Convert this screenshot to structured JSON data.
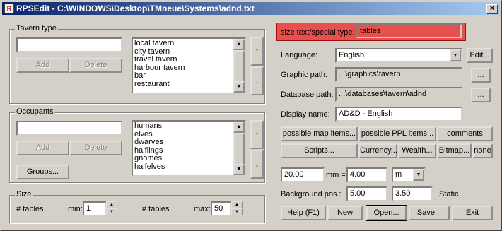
{
  "window": {
    "title": "RPSEdit - C:\\WINDOWS\\Desktop\\TMneue\\Systems\\adnd.txt",
    "app_icon": "R",
    "close_glyph": "×"
  },
  "tavern_type": {
    "label": "Tavern type",
    "input_value": "",
    "add_label": "Add",
    "delete_label": "Delete",
    "items": [
      "local tavern",
      "city tavern",
      "travel tavern",
      "harbour tavern",
      "bar",
      "restaurant"
    ],
    "up_glyph": "↑",
    "down_glyph": "↓"
  },
  "occupants": {
    "label": "Occupants",
    "input_value": "",
    "add_label": "Add",
    "delete_label": "Delete",
    "groups_label": "Groups...",
    "items": [
      "humans",
      "elves",
      "dwarves",
      "halflings",
      "gnomes",
      "halfelves"
    ],
    "up_glyph": "↑",
    "down_glyph": "↓"
  },
  "size": {
    "label": "Size",
    "min_unit": "# tables",
    "min_label": "min:",
    "min_value": "1",
    "max_unit": "# tables",
    "max_label": "max:",
    "max_value": "50"
  },
  "special": {
    "label": "size text/special type:",
    "value": "tables"
  },
  "language": {
    "label": "Language:",
    "value": "English",
    "edit_label": "Edit..."
  },
  "graphic_path": {
    "label": "Graphic path:",
    "value": "...\\graphics\\tavern",
    "browse_label": "..."
  },
  "database_path": {
    "label": "Database path:",
    "value": "...\\databases\\tavern\\adnd",
    "browse_label": "..."
  },
  "display_name": {
    "label": "Display name:",
    "value": "AD&D - English"
  },
  "buttons_row1": {
    "map_items": "possible map items...",
    "ppl_items": "possible PPL items...",
    "comments": "comments"
  },
  "buttons_row2": {
    "scripts": "Scripts...",
    "currency": "Currency...",
    "wealth": "Wealth...",
    "bitmap": "Bitmap...",
    "none": "none"
  },
  "scale": {
    "value1": "20.00",
    "equals_label": "mm =",
    "value2": "4.00",
    "unit": "m"
  },
  "background": {
    "label": "Background pos.:",
    "x": "5.00",
    "y": "3.50",
    "static_label": "Static"
  },
  "bottom_buttons": {
    "help": "Help (F1)",
    "new": "New",
    "open": "Open...",
    "save": "Save...",
    "exit": "Exit"
  },
  "colors": {
    "title_start": "#0a246a",
    "title_end": "#a6caf0",
    "face": "#d4d0c8",
    "highlight_box": "#e8504d"
  }
}
